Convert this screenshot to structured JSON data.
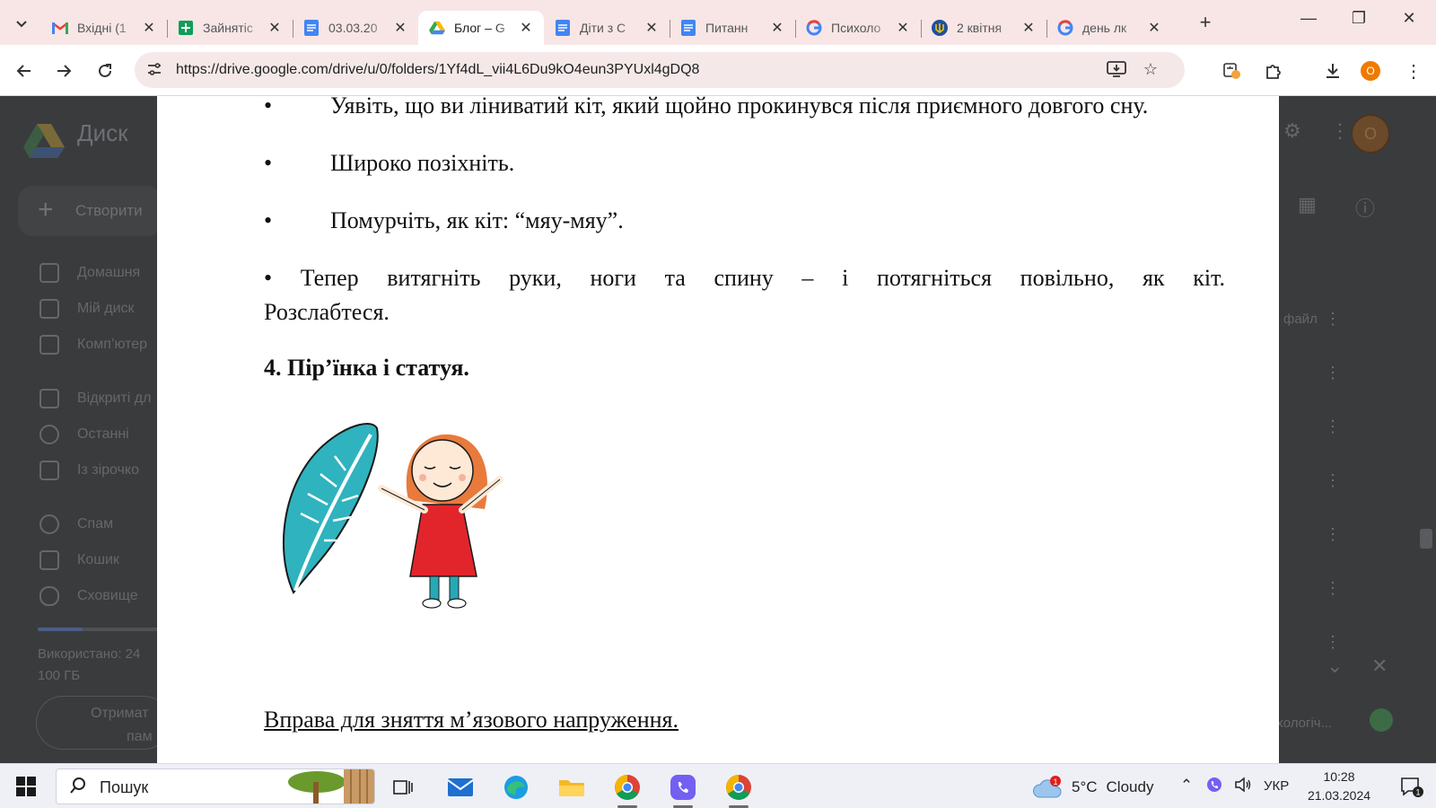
{
  "browser": {
    "tabs": [
      {
        "title": "Вхідні (1",
        "favicon": "gmail-icon",
        "active": false
      },
      {
        "title": "Зайнятіс",
        "favicon": "sheets-icon",
        "active": false
      },
      {
        "title": "03.03.20",
        "favicon": "docs-icon",
        "active": false
      },
      {
        "title": "Блог – G",
        "favicon": "drive-icon",
        "active": true
      },
      {
        "title": "Діти з С",
        "favicon": "docs-icon",
        "active": false
      },
      {
        "title": "Питанн",
        "favicon": "docs-icon",
        "active": false
      },
      {
        "title": "Психоло",
        "favicon": "google-icon",
        "active": false
      },
      {
        "title": "2 квітня",
        "favicon": "trident-icon",
        "active": false
      },
      {
        "title": "день лк",
        "favicon": "google-icon",
        "active": false
      }
    ],
    "address_url": "https://drive.google.com/drive/u/0/folders/1Yf4dL_vii4L6Du9kO4eun3PYUxl4gDQ8",
    "profile_initial": "O"
  },
  "drive": {
    "app_title": "Диск",
    "create_label": "Створити",
    "nav_items": [
      "Домашня",
      "Мій диск",
      "Комп’ютер",
      "Відкриті дл",
      "Останні",
      "Із зірочко",
      "Спам",
      "Кошик",
      "Сховище"
    ],
    "storage_text_line1": "Використано: 24",
    "storage_text_line2": "100 ГБ",
    "storage_fraction": 0.36,
    "get_storage_label": "Отримат",
    "get_storage_label2": "пам",
    "avatar_initial": "O",
    "file_label": "файл",
    "notification_text": "ихологіч..."
  },
  "document": {
    "bullet_char": "•",
    "bullets": [
      "Уявіть, що ви ліниватий кіт, який щойно прокинувся після приємного довгого сну.",
      "Широко позіхніть.",
      "Помурчіть, як кіт: “мяу-мяу”."
    ],
    "stretch_words": [
      "•",
      "Тепер",
      "витягніть",
      "руки,",
      "ноги",
      "та",
      "спину",
      "–",
      "і",
      "потягніться",
      "повільно,",
      "як",
      "кіт."
    ],
    "stretch_tail": "Розслабтеся.",
    "heading": "4. Пір’їнка і статуя.",
    "exercise_title": "Вправа для зняття м’язового напруження."
  },
  "taskbar": {
    "search_label": "Пошук",
    "weather_temp": "5°C",
    "weather_condition": "Cloudy",
    "weather_badge": "1",
    "language": "УКР",
    "time": "10:28",
    "date": "21.03.2024",
    "notification_count": "1"
  }
}
